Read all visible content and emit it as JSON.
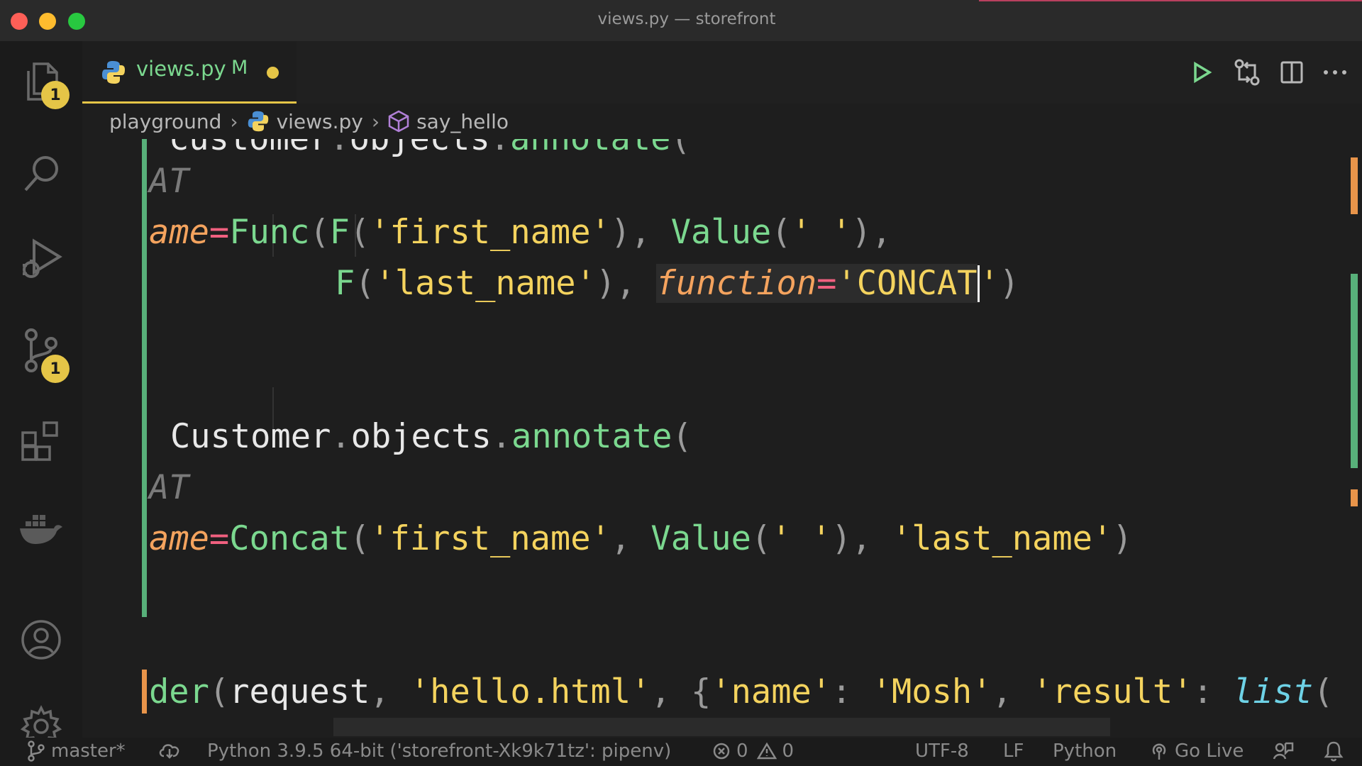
{
  "window": {
    "title": "views.py — storefront"
  },
  "activity_bar": {
    "explorer_badge": "1",
    "source_control_badge": "1"
  },
  "tab": {
    "name": "views.py",
    "status": "M"
  },
  "breadcrumb": {
    "folder": "playground",
    "file": "views.py",
    "symbol": "say_hello"
  },
  "code": {
    "l0": {
      "a": "customer",
      "b": ".",
      "c": "objects",
      "d": ".",
      "e": "annotate",
      "f": "("
    },
    "l1": {
      "a": "AT"
    },
    "l2": {
      "a": "ame",
      "b": "=",
      "c": "Func",
      "d": "(",
      "e": "F",
      "f": "(",
      "g": "'first_name'",
      "h": "),",
      "i": " ",
      "j": "Value",
      "k": "(",
      "l": "' '",
      "m": "),"
    },
    "l3": {
      "a": "F",
      "b": "(",
      "c": "'last_name'",
      "d": "),",
      "e": " ",
      "f": "function",
      "g": "=",
      "h": "'CONCAT",
      "i": "'",
      "j": ")"
    },
    "l4": {
      "a": "Customer",
      "b": ".",
      "c": "objects",
      "d": ".",
      "e": "annotate",
      "f": "("
    },
    "l5": {
      "a": "AT"
    },
    "l6": {
      "a": "ame",
      "b": "=",
      "c": "Concat",
      "d": "(",
      "e": "'first_name'",
      "f": ",",
      "g": " ",
      "h": "Value",
      "i": "(",
      "j": "' '",
      "k": "),",
      "l": " ",
      "m": "'last_name'",
      "n": ")"
    },
    "l7": {
      "a": "der",
      "b": "(",
      "c": "request",
      "d": ",",
      "e": " ",
      "f": "'hello.html'",
      "g": ",",
      "h": " ",
      "i": "{",
      "j": "'name'",
      "k": ":",
      "l": " ",
      "m": "'Mosh'",
      "n": ",",
      "o": " ",
      "p": "'result'",
      "q": ":",
      "r": " ",
      "s": "list",
      "t": "("
    }
  },
  "status_bar": {
    "branch": "master*",
    "interpreter": "Python 3.9.5 64-bit ('storefront-Xk9k71tz': pipenv)",
    "errors": "0",
    "warnings": "0",
    "encoding": "UTF-8",
    "eol": "LF",
    "language": "Python",
    "go_live": "Go Live"
  },
  "colors": {
    "accent_yellow": "#e5c547",
    "git_added": "#58b07a",
    "git_modified": "#e8944a",
    "string": "#f4d35e",
    "function": "#7bd88f",
    "keyword_param": "#f4a35e",
    "operator": "#f0607f"
  }
}
